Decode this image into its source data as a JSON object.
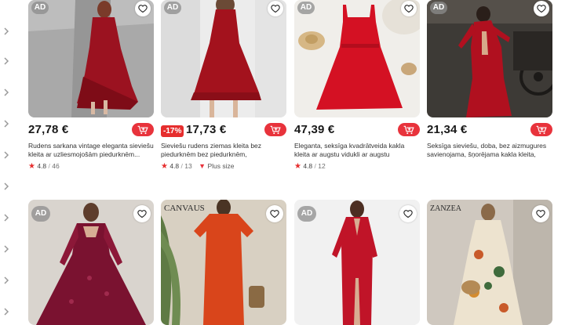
{
  "badges": {
    "ad": "AD"
  },
  "colors": {
    "accent": "#e8333c",
    "star": "#e62e2e",
    "discount": "#e62e2e"
  },
  "icons": {
    "heart": "heart-icon",
    "cart": "cart-add-icon",
    "star": "star-icon",
    "rail": "chevron-right-icon"
  },
  "products": [
    {
      "price": "27,78 €",
      "discount": "",
      "title": "Rudens sarkana vintage eleganta sieviešu kleita ar uzliesmojošām piedurknēm...",
      "rating": "4.8",
      "reviews": "46",
      "plus": "",
      "ad": true
    },
    {
      "price": "17,73 €",
      "discount": "-17%",
      "title": "Sieviešu rudens ziemas kleita bez piedurknēm bez piedurknēm, neformalas...",
      "rating": "4.8",
      "reviews": "13",
      "plus": "Plus size",
      "ad": true
    },
    {
      "price": "47,39 €",
      "discount": "",
      "title": "Eleganta, seksīga kvadrātveida kakla kleita ar augstu vidukli ar augstu jostasvietu",
      "rating": "4.8",
      "reviews": "12",
      "plus": "",
      "ad": true
    },
    {
      "price": "21,34 €",
      "discount": "",
      "title": "Seksīga sieviešu, doba, bez aizmugures savienojama, šņorējama kakla kleita, gara...",
      "rating": "",
      "reviews": "",
      "plus": "",
      "ad": true
    },
    {
      "price": "",
      "discount": "",
      "title": "",
      "rating": "",
      "reviews": "",
      "plus": "",
      "ad": true
    },
    {
      "price": "",
      "discount": "",
      "title": "",
      "rating": "",
      "reviews": "",
      "plus": "",
      "ad": false
    },
    {
      "price": "",
      "discount": "",
      "title": "",
      "rating": "",
      "reviews": "",
      "plus": "",
      "ad": true
    },
    {
      "price": "",
      "discount": "",
      "title": "",
      "rating": "",
      "reviews": "",
      "plus": "",
      "ad": false
    }
  ],
  "watermarks": {
    "p6": "CANVAUS",
    "p8": "ZANZEA"
  }
}
